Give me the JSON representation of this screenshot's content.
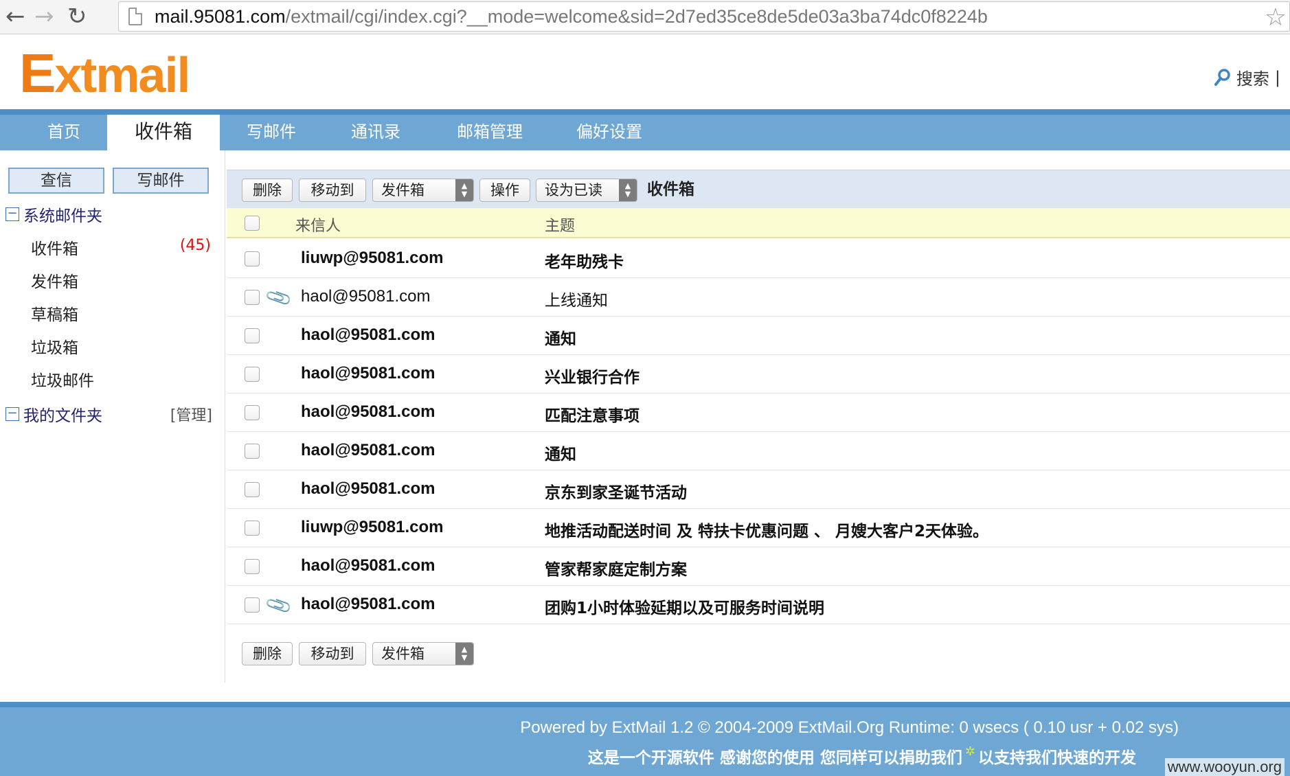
{
  "browser": {
    "back": "←",
    "forward": "→",
    "reload": "↻",
    "url_host": "mail.95081.com",
    "url_path": "/extmail/cgi/index.cgi?__mode=welcome&sid=2d7ed35ce8de5de03a3ba74dc0f8224b",
    "star": "☆"
  },
  "header": {
    "logo_e": "E",
    "logo_rest": "xtmail",
    "search_label": "搜索",
    "search_sep": "|"
  },
  "nav": {
    "tabs": [
      {
        "label": "首页"
      },
      {
        "label": "收件箱"
      },
      {
        "label": "写邮件"
      },
      {
        "label": "通讯录"
      },
      {
        "label": "邮箱管理"
      },
      {
        "label": "偏好设置"
      }
    ],
    "active_index": 1
  },
  "sidebar": {
    "check_mail": "查信",
    "compose": "写邮件",
    "system_folders_label": "系统邮件夹",
    "folders": [
      {
        "label": "收件箱",
        "count": "(45)"
      },
      {
        "label": "发件箱"
      },
      {
        "label": "草稿箱"
      },
      {
        "label": "垃圾箱"
      },
      {
        "label": "垃圾邮件"
      }
    ],
    "my_folders_label": "我的文件夹",
    "manage_label": "[管理]",
    "minus": "−"
  },
  "toolbar": {
    "delete": "删除",
    "move_to": "移动到",
    "move_target": "发件箱",
    "actions": "操作",
    "mark_read": "设为已读",
    "folder_title": "收件箱"
  },
  "list": {
    "col_sender": "来信人",
    "col_subject": "主题",
    "rows": [
      {
        "sender": "liuwp@95081.com",
        "subject": "老年助残卡",
        "unread": true,
        "attachment": false
      },
      {
        "sender": "haol@95081.com",
        "subject": "上线通知",
        "unread": false,
        "attachment": true
      },
      {
        "sender": "haol@95081.com",
        "subject": "通知",
        "unread": true,
        "attachment": false
      },
      {
        "sender": "haol@95081.com",
        "subject": "兴业银行合作",
        "unread": true,
        "attachment": false
      },
      {
        "sender": "haol@95081.com",
        "subject": "匹配注意事项",
        "unread": true,
        "attachment": false
      },
      {
        "sender": "haol@95081.com",
        "subject": "通知",
        "unread": true,
        "attachment": false
      },
      {
        "sender": "haol@95081.com",
        "subject": "京东到家圣诞节活动",
        "unread": true,
        "attachment": false
      },
      {
        "sender": "liuwp@95081.com",
        "subject": "地推活动配送时间 及 特扶卡优惠问题 、 月嫂大客户2天体验。",
        "unread": true,
        "attachment": false
      },
      {
        "sender": "haol@95081.com",
        "subject": "管家帮家庭定制方案",
        "unread": true,
        "attachment": false
      },
      {
        "sender": "haol@95081.com",
        "subject": "团购1小时体验延期以及可服务时间说明",
        "unread": true,
        "attachment": true
      }
    ]
  },
  "bottom_toolbar": {
    "delete": "删除",
    "move_to": "移动到",
    "move_target": "发件箱"
  },
  "footer": {
    "powered": "Powered by ExtMail 1.2 © 2004-2009 ExtMail.Org Runtime: 0 wsecs ( 0.10 usr + 0.02 sys)",
    "line2_a": "这是一个开源软件 感谢您的使用 您同样可以捐助我们",
    "line2_b": "以支持我们快速的开发",
    "watermark": "www.wooyun.org"
  },
  "colors": {
    "nav_bg": "#6fa7d4",
    "logo_orange": "#f07a13",
    "unread_red": "#e01010",
    "header_row_bg": "#fcfcd2"
  }
}
